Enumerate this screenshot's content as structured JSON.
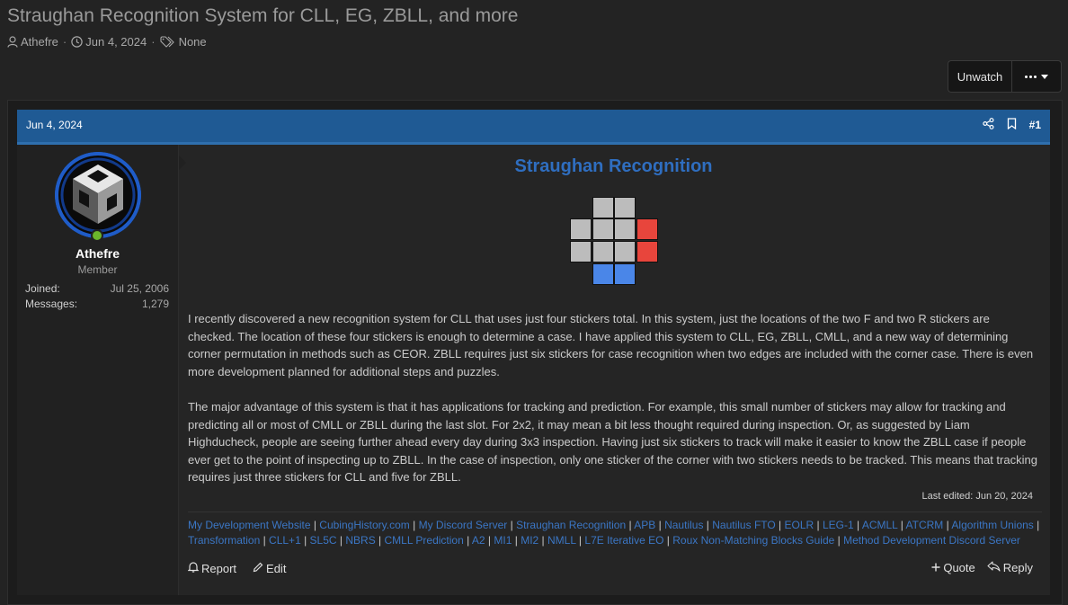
{
  "thread": {
    "title": "Straughan Recognition System for CLL, EG, ZBLL, and more",
    "author": "Athefre",
    "date": "Jun 4, 2024",
    "tags": "None",
    "sep": "·"
  },
  "buttons": {
    "unwatch": "Unwatch"
  },
  "post": {
    "date": "Jun 4, 2024",
    "number": "#1",
    "user": {
      "name": "Athefre",
      "title": "Member",
      "joined_label": "Joined:",
      "joined_value": "Jul 25, 2006",
      "messages_label": "Messages:",
      "messages_value": "1,279"
    },
    "heading": "Straughan Recognition",
    "paragraph1": "I recently discovered a new recognition system for CLL that uses just four stickers total. In this system, just the locations of the two F and two R stickers are checked. The location of these four stickers is enough to determine a case. I have applied this system to CLL, EG, ZBLL, CMLL, and a new way of determining corner permutation in methods such as CEOR. ZBLL requires just six stickers for case recognition when two edges are included with the corner case. There is even more development planned for additional steps and puzzles.",
    "paragraph2": "The major advantage of this system is that it has applications for tracking and prediction. For example, this small number of stickers may allow for tracking and predicting all or most of CMLL or ZBLL during the last slot. For 2x2, it may mean a bit less thought required during inspection. Or, as suggested by Liam Highducheck, people are seeing further ahead every day during 3x3 inspection. Having just six stickers to track will make it easier to know the ZBLL case if people ever get to the point of inspecting up to ZBLL. In the case of inspection, only one sticker of the corner with two stickers needs to be tracked. This means that tracking requires just three stickers for CLL and five for ZBLL.",
    "last_edited": "Last edited: Jun 20, 2024",
    "sticker_colors": {
      "gray": "#bcbcbc",
      "red": "#e8453c",
      "blue": "#4a86e8"
    },
    "signature_links": [
      "My Development Website",
      "CubingHistory.com",
      "My Discord Server",
      "Straughan Recognition",
      "APB",
      "Nautilus",
      "Nautilus FTO",
      "EOLR",
      "LEG-1",
      "ACMLL",
      "ATCRM",
      "Algorithm Unions",
      "Transformation",
      "CLL+1",
      "SL5C",
      "NBRS",
      "CMLL Prediction",
      "A2",
      "MI1",
      "MI2",
      "NMLL",
      "L7E Iterative EO",
      "Roux Non-Matching Blocks Guide",
      "Method Development Discord Server"
    ],
    "actions": {
      "report": "Report",
      "edit": "Edit",
      "quote": "Quote",
      "reply": "Reply"
    }
  }
}
